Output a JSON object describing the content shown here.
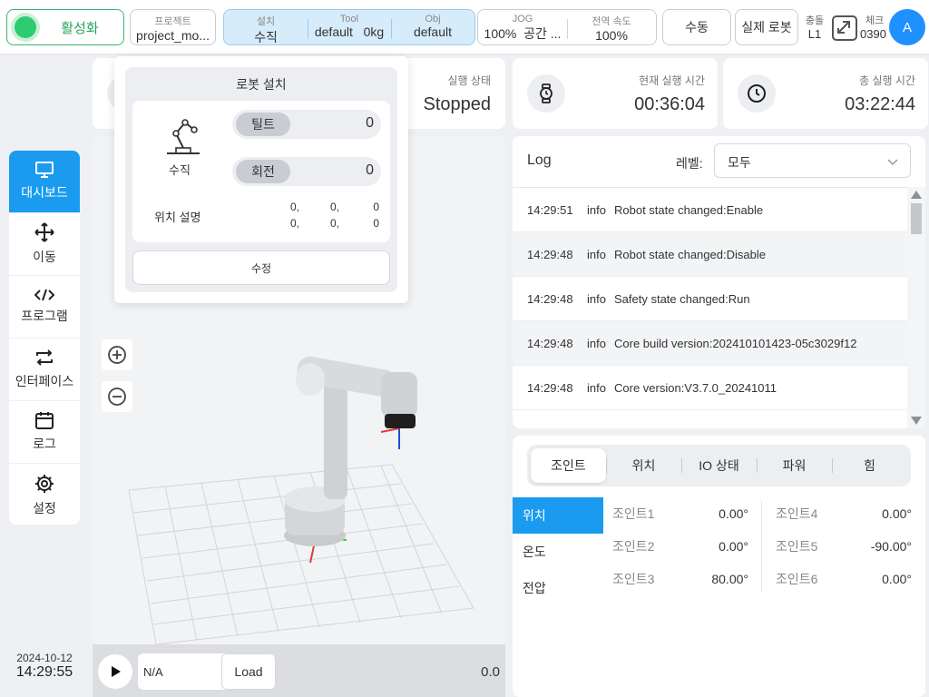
{
  "topbar": {
    "activate_label": "활성화",
    "project_caption": "프로젝트",
    "project_value": "project_mo...",
    "install": [
      {
        "caption": "설치",
        "value": "수직"
      },
      {
        "caption": "Tool",
        "value": "default   0kg"
      },
      {
        "caption": "Obj",
        "value": "default"
      }
    ],
    "jog": [
      {
        "caption": "JOG",
        "value": "100%  공간 ..."
      },
      {
        "caption": "전역 속도",
        "value": "100%"
      }
    ],
    "manual_label": "수동",
    "real_robot_label": "실제 로봇",
    "collision_caption": "충돌",
    "collision_value": "L1",
    "check_caption": "체크",
    "check_value": "0390",
    "avatar_letter": "A"
  },
  "status": {
    "run_state_caption": "실행 상태",
    "run_state_value": "Stopped",
    "current_runtime_caption": "현재 실행 시간",
    "current_runtime_value": "00:36:04",
    "total_runtime_caption": "총 실행 시간",
    "total_runtime_value": "03:22:44"
  },
  "sidebar": {
    "items": [
      {
        "label": "대시보드",
        "icon": "monitor-icon"
      },
      {
        "label": "이동",
        "icon": "move-icon"
      },
      {
        "label": "프로그램",
        "icon": "code-icon"
      },
      {
        "label": "인터페이스",
        "icon": "swap-icon"
      },
      {
        "label": "로그",
        "icon": "calendar-icon"
      },
      {
        "label": "설정",
        "icon": "gear-icon"
      }
    ],
    "active_index": 0
  },
  "clock": {
    "date": "2024-10-12",
    "time": "14:29:55"
  },
  "popover": {
    "title": "로봇 설치",
    "robot_label": "수직",
    "tilt_label": "틸트",
    "tilt_value": "0",
    "rotate_label": "회전",
    "rotate_value": "0",
    "position_label": "위치 설명",
    "position_values": [
      "0,",
      "0,",
      "0",
      "0,",
      "0,",
      "0"
    ],
    "edit_label": "수정"
  },
  "viewport": {
    "program_name": "N/A",
    "load_label": "Load",
    "speed_value": "0.0"
  },
  "log": {
    "title": "Log",
    "level_label": "레벨:",
    "level_value": "모두",
    "rows": [
      {
        "time": "14:29:51",
        "level": "info",
        "message": "Robot state changed:Enable"
      },
      {
        "time": "14:29:48",
        "level": "info",
        "message": "Robot state changed:Disable"
      },
      {
        "time": "14:29:48",
        "level": "info",
        "message": "Safety state changed:Run"
      },
      {
        "time": "14:29:48",
        "level": "info",
        "message": "Core build version:202410101423-05c3029f12"
      },
      {
        "time": "14:29:48",
        "level": "info",
        "message": "Core version:V3.7.0_20241011"
      }
    ]
  },
  "joint_panel": {
    "tabs": [
      "조인트",
      "위치",
      "IO 상태",
      "파워",
      "힘"
    ],
    "active_tab": 0,
    "subnav": [
      "위치",
      "온도",
      "전압"
    ],
    "active_sub": 0,
    "joints": [
      {
        "name": "조인트1",
        "value": "0.00°"
      },
      {
        "name": "조인트2",
        "value": "0.00°"
      },
      {
        "name": "조인트3",
        "value": "80.00°"
      },
      {
        "name": "조인트4",
        "value": "0.00°"
      },
      {
        "name": "조인트5",
        "value": "-90.00°"
      },
      {
        "name": "조인트6",
        "value": "0.00°"
      }
    ]
  }
}
